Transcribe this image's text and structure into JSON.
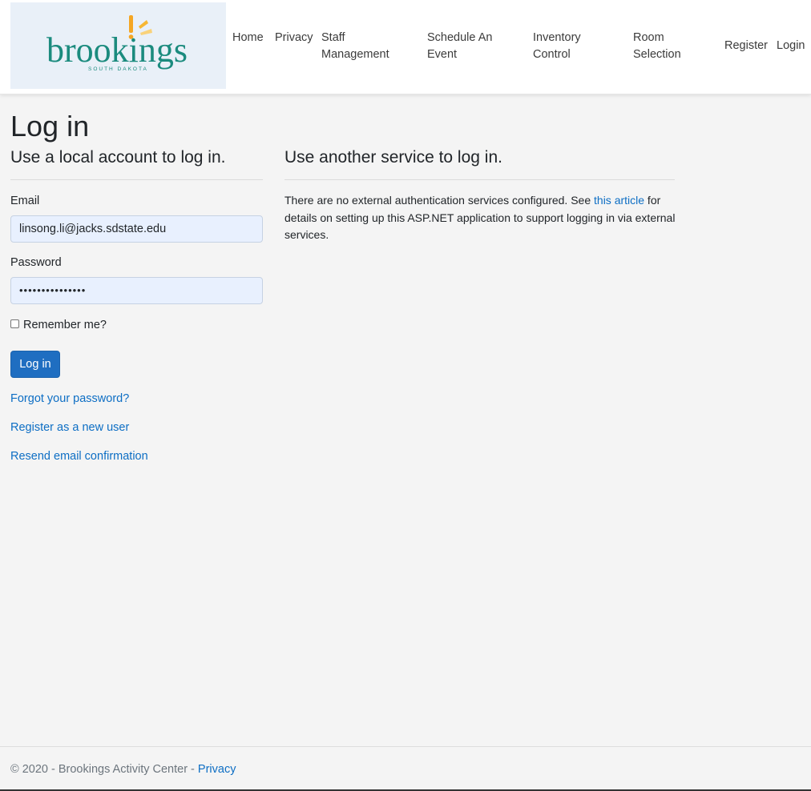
{
  "brand": {
    "logo_name": "brookings",
    "logo_sub": "SOUTH DAKOTA"
  },
  "nav": {
    "home": "Home",
    "privacy": "Privacy",
    "staff_1": "Staff",
    "staff_2": "Management",
    "schedule_1": "Schedule An",
    "schedule_2": "Event",
    "inventory_1": "Inventory",
    "inventory_2": "Control",
    "room_1": "Room",
    "room_2": "Selection",
    "register": "Register",
    "login": "Login"
  },
  "page": {
    "title": "Log in"
  },
  "local": {
    "heading": "Use a local account to log in.",
    "email_label": "Email",
    "email_value": "linsong.li@jacks.sdstate.edu",
    "password_label": "Password",
    "password_value": "•••••••••••••••",
    "remember_label": "Remember me?",
    "login_button": "Log in",
    "forgot_link": "Forgot your password?",
    "register_link": "Register as a new user",
    "resend_link": "Resend email confirmation"
  },
  "external": {
    "heading": "Use another service to log in.",
    "text_before": "There are no external authentication services configured. See ",
    "link_text": "this article",
    "text_after": " for details on setting up this ASP.NET application to support logging in via external services."
  },
  "footer": {
    "copyright": "© 2020 - Brookings Activity Center - ",
    "privacy_link": "Privacy"
  },
  "colors": {
    "primary": "#1f6ec1",
    "link": "#0d6ec4",
    "logo_teal": "#1b8b7e",
    "logo_sun": "#f5a623"
  }
}
